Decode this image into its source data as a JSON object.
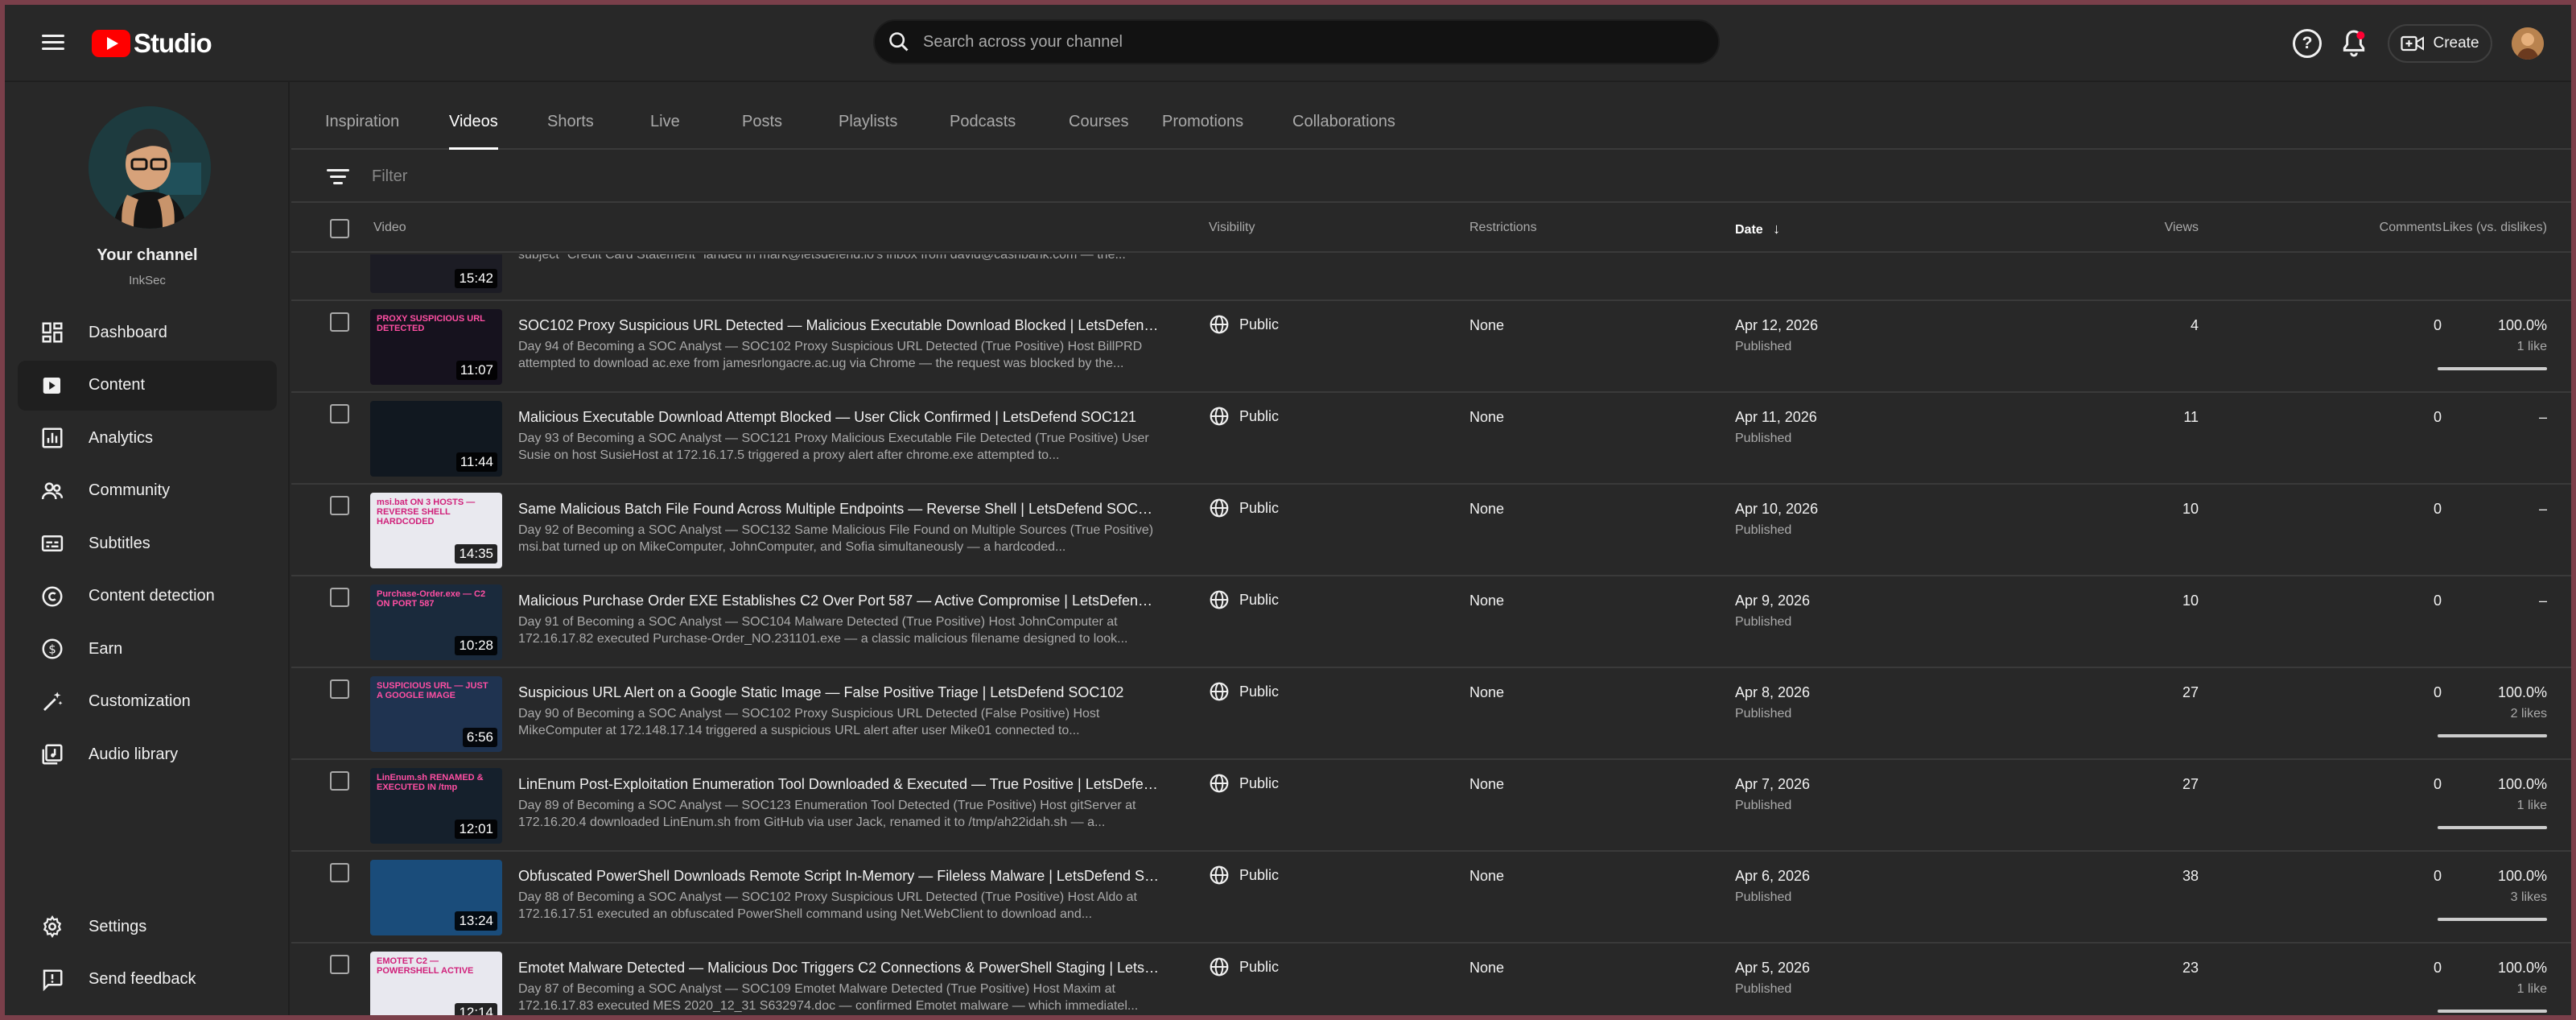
{
  "app": {
    "logo_text": "Studio"
  },
  "search": {
    "placeholder": "Search across your channel"
  },
  "header": {
    "create_label": "Create"
  },
  "channel": {
    "title": "Your channel",
    "name": "InkSec"
  },
  "sidebar": {
    "items": [
      {
        "label": "Dashboard",
        "icon": "dashboard-icon"
      },
      {
        "label": "Content",
        "icon": "content-icon",
        "active": true
      },
      {
        "label": "Analytics",
        "icon": "analytics-icon"
      },
      {
        "label": "Community",
        "icon": "community-icon"
      },
      {
        "label": "Subtitles",
        "icon": "subtitles-icon"
      },
      {
        "label": "Content detection",
        "icon": "copyright-icon"
      },
      {
        "label": "Earn",
        "icon": "dollar-icon"
      },
      {
        "label": "Customization",
        "icon": "magic-wand-icon"
      },
      {
        "label": "Audio library",
        "icon": "audio-library-icon"
      }
    ],
    "bottom": [
      {
        "label": "Settings",
        "icon": "gear-icon"
      },
      {
        "label": "Send feedback",
        "icon": "feedback-icon"
      }
    ]
  },
  "tabs": [
    "Inspiration",
    "Videos",
    "Shorts",
    "Live",
    "Posts",
    "Playlists",
    "Podcasts",
    "Courses",
    "Promotions",
    "Collaborations"
  ],
  "active_tab": "Videos",
  "filter": {
    "placeholder": "Filter"
  },
  "table": {
    "headers": {
      "video": "Video",
      "visibility": "Visibility",
      "restrictions": "Restrictions",
      "date": "Date",
      "views": "Views",
      "comments": "Comments",
      "likes": "Likes (vs. dislikes)"
    },
    "partial_row": {
      "duration": "15:42",
      "description": "subject \"Credit Card Statement\" landed in mark@letsdefend.io's inbox from david@cashbank.com — the..."
    },
    "rows": [
      {
        "duration": "11:07",
        "thumb_text": "PROXY SUSPICIOUS URL DETECTED",
        "thumb_color": "#16121e",
        "title": "SOC102 Proxy Suspicious URL Detected — Malicious Executable Download Blocked | LetsDefend Al...",
        "description": "Day 94 of Becoming a SOC Analyst — SOC102 Proxy Suspicious URL Detected (True Positive) Host BillPRD attempted to download ac.exe from jamesrlongacre.ac.ug via Chrome — the request was blocked by the...",
        "visibility": "Public",
        "restrictions": "None",
        "date": "Apr 12, 2026",
        "status": "Published",
        "views": "4",
        "comments": "0",
        "likes_pct": "100.0%",
        "likes_count": "1 like",
        "likes_fill": 1.0
      },
      {
        "duration": "11:44",
        "thumb_text": "",
        "thumb_color": "#111820",
        "title": "Malicious Executable Download Attempt Blocked — User Click Confirmed | LetsDefend SOC121",
        "description": "Day 93 of Becoming a SOC Analyst — SOC121 Proxy Malicious Executable File Detected (True Positive) User Susie on host SusieHost at 172.16.17.5 triggered a proxy alert after chrome.exe attempted to...",
        "visibility": "Public",
        "restrictions": "None",
        "date": "Apr 11, 2026",
        "status": "Published",
        "views": "11",
        "comments": "0",
        "likes_pct": "–",
        "likes_count": "",
        "likes_fill": null
      },
      {
        "duration": "14:35",
        "thumb_text": "msi.bat ON 3 HOSTS — REVERSE SHELL HARDCODED",
        "thumb_color": "#e9e9ef",
        "title": "Same Malicious Batch File Found Across Multiple Endpoints — Reverse Shell | LetsDefend SOC132",
        "description": "Day 92 of Becoming a SOC Analyst — SOC132 Same Malicious File Found on Multiple Sources (True Positive) msi.bat turned up on MikeComputer, JohnComputer, and Sofia simultaneously — a hardcoded...",
        "visibility": "Public",
        "restrictions": "None",
        "date": "Apr 10, 2026",
        "status": "Published",
        "views": "10",
        "comments": "0",
        "likes_pct": "–",
        "likes_count": "",
        "likes_fill": null
      },
      {
        "duration": "10:28",
        "thumb_text": "Purchase-Order.exe — C2 ON PORT 587",
        "thumb_color": "#1a2a3c",
        "title": "Malicious Purchase Order EXE Establishes C2 Over Port 587 — Active Compromise | LetsDefend SO...",
        "description": "Day 91 of Becoming a SOC Analyst — SOC104 Malware Detected (True Positive) Host JohnComputer at 172.16.17.82 executed Purchase-Order_NO.231101.exe — a classic malicious filename designed to look...",
        "visibility": "Public",
        "restrictions": "None",
        "date": "Apr 9, 2026",
        "status": "Published",
        "views": "10",
        "comments": "0",
        "likes_pct": "–",
        "likes_count": "",
        "likes_fill": null
      },
      {
        "duration": "6:56",
        "thumb_text": "SUSPICIOUS URL — JUST A GOOGLE IMAGE",
        "thumb_color": "#1f3350",
        "title": "Suspicious URL Alert on a Google Static Image — False Positive Triage | LetsDefend SOC102",
        "description": "Day 90 of Becoming a SOC Analyst — SOC102 Proxy Suspicious URL Detected (False Positive) Host MikeComputer at 172.148.17.14 triggered a suspicious URL alert after user Mike01 connected to...",
        "visibility": "Public",
        "restrictions": "None",
        "date": "Apr 8, 2026",
        "status": "Published",
        "views": "27",
        "comments": "0",
        "likes_pct": "100.0%",
        "likes_count": "2 likes",
        "likes_fill": 1.0
      },
      {
        "duration": "12:01",
        "thumb_text": "LinEnum.sh RENAMED & EXECUTED IN /tmp",
        "thumb_color": "#15202c",
        "title": "LinEnum Post-Exploitation Enumeration Tool Downloaded & Executed — True Positive | LetsDefend ...",
        "description": "Day 89 of Becoming a SOC Analyst — SOC123 Enumeration Tool Detected (True Positive) Host gitServer at 172.16.20.4 downloaded LinEnum.sh from GitHub via user Jack, renamed it to /tmp/ah22idah.sh — a...",
        "visibility": "Public",
        "restrictions": "None",
        "date": "Apr 7, 2026",
        "status": "Published",
        "views": "27",
        "comments": "0",
        "likes_pct": "100.0%",
        "likes_count": "1 like",
        "likes_fill": 1.0
      },
      {
        "duration": "13:24",
        "thumb_text": "",
        "thumb_color": "#1a4c7a",
        "title": "Obfuscated PowerShell Downloads Remote Script In-Memory — Fileless Malware | LetsDefend SOC...",
        "description": "Day 88 of Becoming a SOC Analyst — SOC102 Proxy Suspicious URL Detected (True Positive) Host Aldo at 172.16.17.51 executed an obfuscated PowerShell command using Net.WebClient to download and...",
        "visibility": "Public",
        "restrictions": "None",
        "date": "Apr 6, 2026",
        "status": "Published",
        "views": "38",
        "comments": "0",
        "likes_pct": "100.0%",
        "likes_count": "3 likes",
        "likes_fill": 1.0
      },
      {
        "duration": "12:14",
        "thumb_text": "EMOTET C2 — POWERSHELL ACTIVE",
        "thumb_color": "#e8e8ef",
        "title": "Emotet Malware Detected — Malicious Doc Triggers C2 Connections & PowerShell Staging | LetsDef...",
        "description": "Day 87 of Becoming a SOC Analyst — SOC109 Emotet Malware Detected (True Positive) Host Maxim at 172.16.17.83 executed MES 2020_12_31 S632974.doc — confirmed Emotet malware — which immediatel...",
        "visibility": "Public",
        "restrictions": "None",
        "date": "Apr 5, 2026",
        "status": "Published",
        "views": "23",
        "comments": "0",
        "likes_pct": "100.0%",
        "likes_count": "1 like",
        "likes_fill": 1.0
      }
    ]
  },
  "colors": {
    "background": "#282828",
    "accent_red": "#ff0000",
    "text": "#f1f1f1",
    "muted": "#aaaaaa"
  }
}
